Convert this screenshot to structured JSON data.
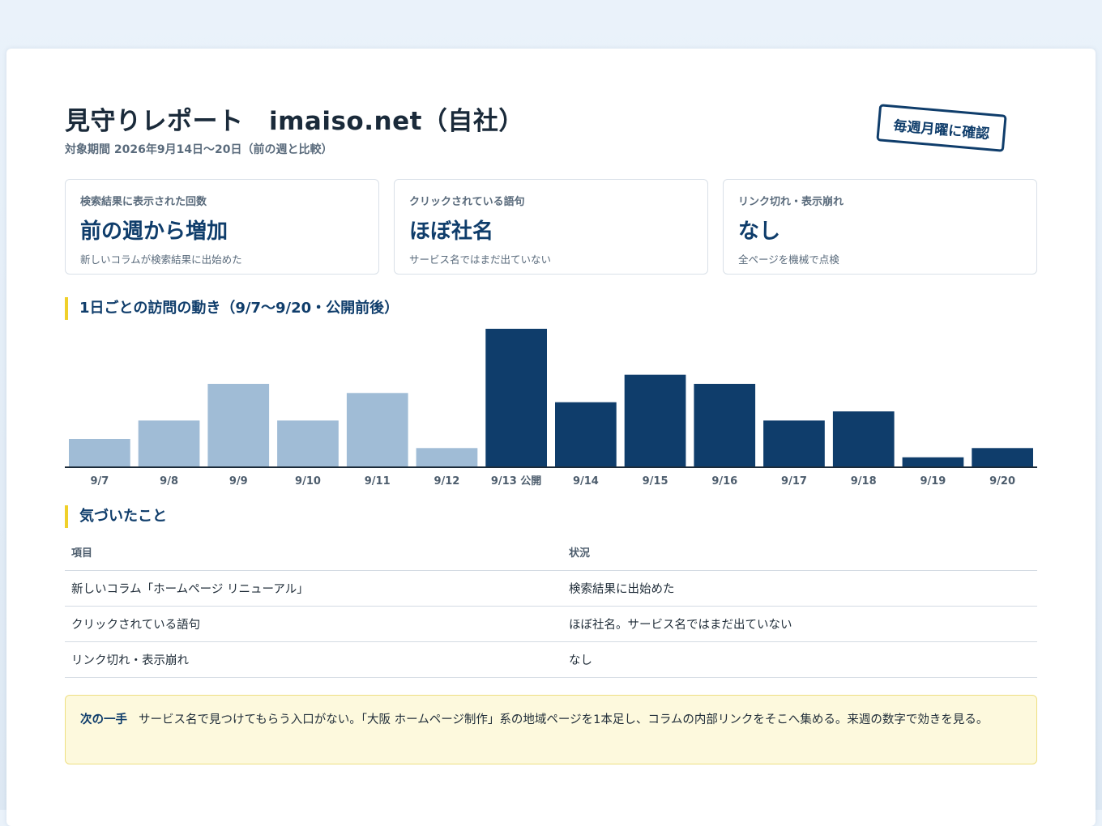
{
  "header": {
    "title": "見守りレポート　imaiso.net（自社）",
    "period": "対象期間 2026年9月14日〜20日（前の週と比較）",
    "stamp": "毎週月曜に確認"
  },
  "kpis": [
    {
      "label": "検索結果に表示された回数",
      "value": "前の週から増加",
      "note": "新しいコラムが検索結果に出始めた"
    },
    {
      "label": "クリックされている語句",
      "value": "ほぼ社名",
      "note": "サービス名ではまだ出ていない"
    },
    {
      "label": "リンク切れ・表示崩れ",
      "value": "なし",
      "note": "全ページを機械で点検"
    }
  ],
  "chart_section": {
    "heading": "1日ごとの訪問の動き（9/7〜9/20・公開前後）"
  },
  "chart_data": {
    "type": "bar",
    "title": "1日ごとの訪問の動き（9/7〜9/20・公開前後）",
    "categories": [
      "9/7",
      "9/8",
      "9/9",
      "9/10",
      "9/11",
      "9/12",
      "9/13 公開",
      "9/14",
      "9/15",
      "9/16",
      "9/17",
      "9/18",
      "9/19",
      "9/20"
    ],
    "values": [
      3,
      5,
      9,
      5,
      8,
      2,
      15,
      7,
      10,
      9,
      5,
      6,
      1,
      2
    ],
    "ylim": [
      0,
      15
    ],
    "colors": {
      "before": "#a0bcd6",
      "after": "#0f3d6b",
      "axis": "#1c2b39",
      "tick_label": "#4d5d6d"
    },
    "highlight_from_index": 6,
    "grid": false
  },
  "notes": {
    "heading": "気づいたこと",
    "columns": [
      "項目",
      "状況"
    ],
    "rows": [
      [
        "新しいコラム「ホームページ リニューアル」",
        "検索結果に出始めた"
      ],
      [
        "クリックされている語句",
        "ほぼ社名。サービス名ではまだ出ていない"
      ],
      [
        "リンク切れ・表示崩れ",
        "なし"
      ]
    ]
  },
  "next_step": {
    "label": "次の一手",
    "text": "サービス名で見つけてもらう入口がない。「大阪 ホームページ制作」系の地域ページを1本足し、コラムの内部リンクをそこへ集める。来週の数字で効きを見る。"
  }
}
